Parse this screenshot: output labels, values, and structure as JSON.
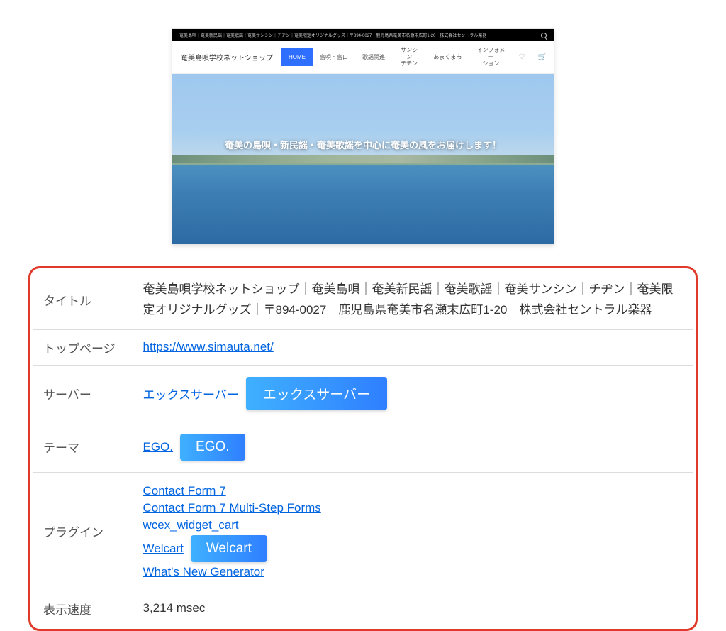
{
  "screenshot": {
    "topbar_text": "奄美島唄｜奄美新民謡｜奄美歌謡｜奄美サンシン｜チヂン｜奄美限定オリジナルグッズ｜〒894-0027　鹿児島県奄美市名瀬末広町1-20　株式会社セントラル楽器",
    "brand": "奄美島唄学校ネットショップ",
    "nav": {
      "home": "HOME",
      "item1": "島唄・島口",
      "item2": "歌謡関連",
      "item3": "サンシン\nチヂン",
      "item4": "あまくま市",
      "item5": "インフォメー\nション"
    },
    "hero_text": "奄美の島唄・新民謡・奄美歌謡を中心に奄美の風をお届けします！"
  },
  "labels": {
    "title": "タイトル",
    "toppage": "トップページ",
    "server": "サーバー",
    "theme": "テーマ",
    "plugins": "プラグイン",
    "speed": "表示速度"
  },
  "values": {
    "title": "奄美島唄学校ネットショップ｜奄美島唄｜奄美新民謡｜奄美歌謡｜奄美サンシン｜チヂン｜奄美限定オリジナルグッズ｜〒894-0027　鹿児島県奄美市名瀬末広町1-20　株式会社セントラル楽器",
    "toppage_url": "https://www.simauta.net/",
    "server_link": "エックスサーバー",
    "server_btn": "エックスサーバー",
    "theme_link": "EGO.",
    "theme_btn": "EGO.",
    "plugins": {
      "p1": "Contact Form 7",
      "p2": "Contact Form 7 Multi-Step Forms",
      "p3": "wcex_widget_cart",
      "p4_link": "Welcart",
      "p4_btn": "Welcart",
      "p5": "What's New Generator"
    },
    "speed": "3,214 msec"
  }
}
